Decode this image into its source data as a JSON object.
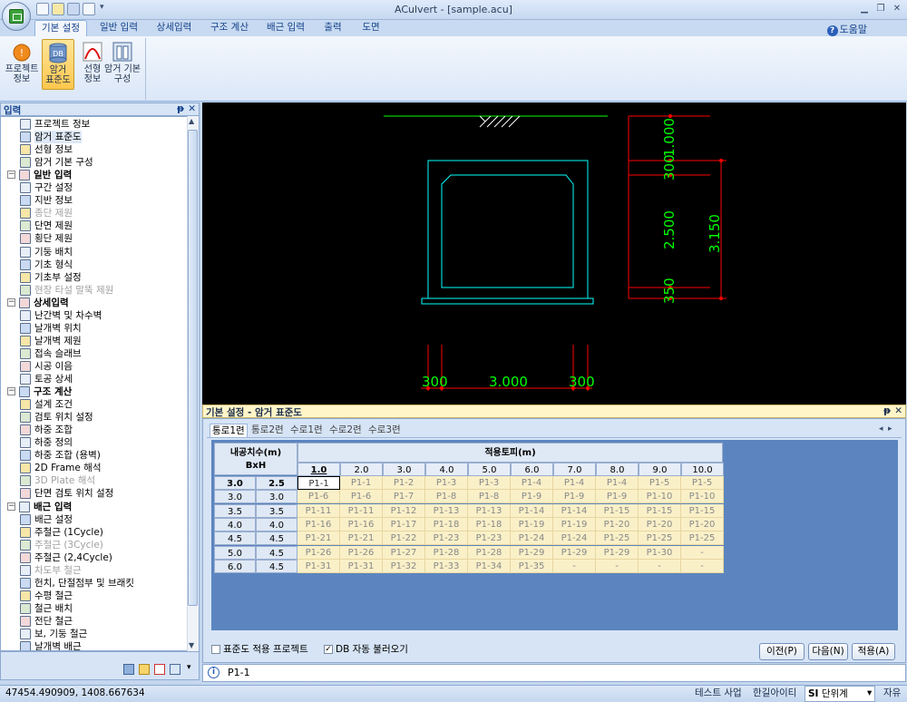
{
  "window": {
    "title": "ACulvert - [sample.acu]"
  },
  "ribbon": {
    "tabs": [
      "기본 설정",
      "일반 입력",
      "상세입력",
      "구조 계산",
      "배근 입력",
      "출력",
      "도면"
    ],
    "help_label": "도움말",
    "buttons": [
      {
        "label1": "프로젝트",
        "label2": "정보"
      },
      {
        "label1": "암거",
        "label2": "표준도",
        "badge": "DB"
      },
      {
        "label1": "선형",
        "label2": "정보"
      },
      {
        "label1": "암거 기본",
        "label2": "구성"
      }
    ]
  },
  "left_panel": {
    "title": "입력",
    "items": [
      {
        "label": "프로젝트 정보",
        "type": "item"
      },
      {
        "label": "암거 표준도",
        "type": "item",
        "selected": true
      },
      {
        "label": "선형 정보",
        "type": "item"
      },
      {
        "label": "암거 기본 구성",
        "type": "item"
      },
      {
        "label": "일반 입력",
        "type": "group"
      },
      {
        "label": "구간 설정",
        "type": "item"
      },
      {
        "label": "지반 정보",
        "type": "item"
      },
      {
        "label": "종단 제원",
        "type": "item",
        "disabled": true
      },
      {
        "label": "단면 제원",
        "type": "item"
      },
      {
        "label": "횡단 제원",
        "type": "item"
      },
      {
        "label": "기둥 배치",
        "type": "item"
      },
      {
        "label": "기초 형식",
        "type": "item"
      },
      {
        "label": "기초부 설정",
        "type": "item"
      },
      {
        "label": "현장 타설 말뚝 제원",
        "type": "item",
        "disabled": true
      },
      {
        "label": "상세입력",
        "type": "group"
      },
      {
        "label": "난간벽 및 차수벽",
        "type": "item"
      },
      {
        "label": "날개벽 위치",
        "type": "item"
      },
      {
        "label": "날개벽 제원",
        "type": "item"
      },
      {
        "label": "접속 슬래브",
        "type": "item"
      },
      {
        "label": "시공 이음",
        "type": "item"
      },
      {
        "label": "토공 상세",
        "type": "item"
      },
      {
        "label": "구조 계산",
        "type": "group"
      },
      {
        "label": "설계 조건",
        "type": "item"
      },
      {
        "label": "검토 위치 설정",
        "type": "item"
      },
      {
        "label": "하중 조합",
        "type": "item"
      },
      {
        "label": "하중 정의",
        "type": "item"
      },
      {
        "label": "하중 조합 (용벽)",
        "type": "item"
      },
      {
        "label": "2D Frame 해석",
        "type": "item"
      },
      {
        "label": "3D Plate 해석",
        "type": "item",
        "disabled": true
      },
      {
        "label": "단면 검토 위치 설정",
        "type": "item"
      },
      {
        "label": "배근 입력",
        "type": "group"
      },
      {
        "label": "배근 설정",
        "type": "item"
      },
      {
        "label": "주철근 (1Cycle)",
        "type": "item"
      },
      {
        "label": "주철근 (3Cycle)",
        "type": "item",
        "disabled": true
      },
      {
        "label": "주철근 (2,4Cycle)",
        "type": "item"
      },
      {
        "label": "차도부 철근",
        "type": "item",
        "disabled": true
      },
      {
        "label": "헌치, 단절점부 및 브래킷",
        "type": "item"
      },
      {
        "label": "수평 철근",
        "type": "item"
      },
      {
        "label": "철근 배치",
        "type": "item"
      },
      {
        "label": "전단 철근",
        "type": "item"
      },
      {
        "label": "보, 기둥 철근",
        "type": "item"
      },
      {
        "label": "날개벽 배근",
        "type": "item"
      }
    ]
  },
  "drawing": {
    "dims_right": [
      "1.000",
      "300",
      "2.500",
      "3.150",
      "350"
    ],
    "dims_bottom": [
      "300",
      "3.000",
      "300"
    ],
    "colors": {
      "structure": "#00ffff",
      "dim_text": "#00ff00",
      "dim_line": "#ff0000",
      "ground": "#00ff00"
    }
  },
  "bottom_panel": {
    "title": "기본 설정 - 암거 표준도",
    "tabs": [
      "통로1련",
      "통로2련",
      "수로1련",
      "수로2련",
      "수로3련"
    ],
    "active_tab": 0,
    "table": {
      "row_header_title1": "내공치수(m)",
      "row_header_title2": "BxH",
      "col_group_title": "적용토피(m)",
      "col_headers": [
        "1.0",
        "2.0",
        "3.0",
        "4.0",
        "5.0",
        "6.0",
        "7.0",
        "8.0",
        "9.0",
        "10.0"
      ],
      "rows": [
        {
          "b": "3.0",
          "h": "2.5",
          "cells": [
            "P1-1",
            "P1-1",
            "P1-2",
            "P1-3",
            "P1-3",
            "P1-4",
            "P1-4",
            "P1-4",
            "P1-5",
            "P1-5"
          ]
        },
        {
          "b": "3.0",
          "h": "3.0",
          "cells": [
            "P1-6",
            "P1-6",
            "P1-7",
            "P1-8",
            "P1-8",
            "P1-9",
            "P1-9",
            "P1-9",
            "P1-10",
            "P1-10"
          ]
        },
        {
          "b": "3.5",
          "h": "3.5",
          "cells": [
            "P1-11",
            "P1-11",
            "P1-12",
            "P1-13",
            "P1-13",
            "P1-14",
            "P1-14",
            "P1-15",
            "P1-15",
            "P1-15"
          ]
        },
        {
          "b": "4.0",
          "h": "4.0",
          "cells": [
            "P1-16",
            "P1-16",
            "P1-17",
            "P1-18",
            "P1-18",
            "P1-19",
            "P1-19",
            "P1-20",
            "P1-20",
            "P1-20"
          ]
        },
        {
          "b": "4.5",
          "h": "4.5",
          "cells": [
            "P1-21",
            "P1-21",
            "P1-22",
            "P1-23",
            "P1-23",
            "P1-24",
            "P1-24",
            "P1-25",
            "P1-25",
            "P1-25"
          ]
        },
        {
          "b": "5.0",
          "h": "4.5",
          "cells": [
            "P1-26",
            "P1-26",
            "P1-27",
            "P1-28",
            "P1-28",
            "P1-29",
            "P1-29",
            "P1-29",
            "P1-30",
            "-"
          ]
        },
        {
          "b": "6.0",
          "h": "4.5",
          "cells": [
            "P1-31",
            "P1-31",
            "P1-32",
            "P1-33",
            "P1-34",
            "P1-35",
            "-",
            "-",
            "-",
            "-"
          ]
        }
      ]
    },
    "checkbox1": "표준도 적용 프로젝트",
    "checkbox1_checked": false,
    "checkbox2": "DB 자동 불러오기",
    "checkbox2_checked": true,
    "btn_prev": "이전(P)",
    "btn_next": "다음(N)",
    "btn_apply": "적용(A)"
  },
  "info_text": "P1-1",
  "status": {
    "coords": "47454.490909,   1408.667634",
    "company1": "테스트 사업",
    "company2": "한길아이티",
    "unit_prefix": "SI",
    "unit_label": "단위계",
    "free": "자유"
  }
}
